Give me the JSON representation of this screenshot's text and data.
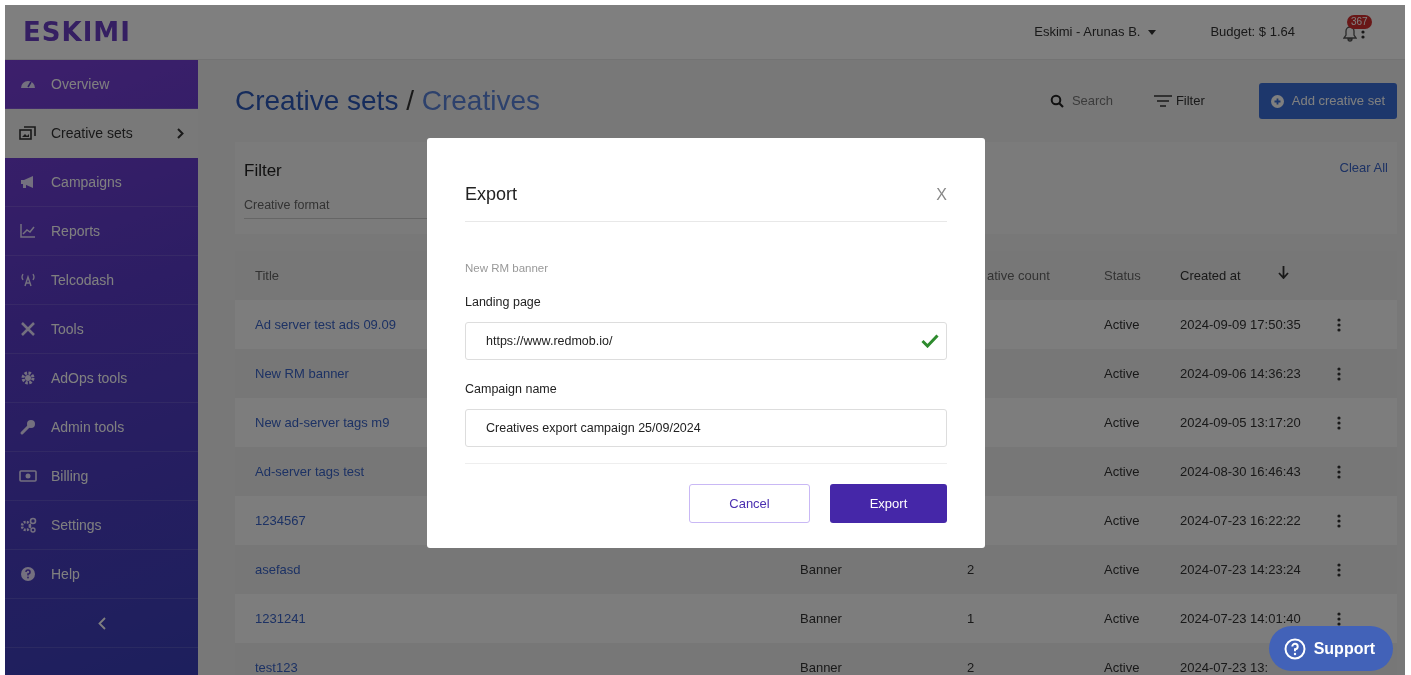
{
  "topbar": {
    "logo": "ESKIMI",
    "account": "Eskimi - Arunas B.",
    "budget": "Budget: $ 1.64",
    "notifications": "367"
  },
  "sidebar": {
    "items": [
      {
        "label": "Overview",
        "selected": false
      },
      {
        "label": "Creative sets",
        "selected": true
      },
      {
        "label": "Campaigns",
        "selected": false
      },
      {
        "label": "Reports",
        "selected": false
      },
      {
        "label": "Telcodash",
        "selected": false
      },
      {
        "label": "Tools",
        "selected": false
      },
      {
        "label": "AdOps tools",
        "selected": false
      },
      {
        "label": "Admin tools",
        "selected": false
      },
      {
        "label": "Billing",
        "selected": false
      },
      {
        "label": "Settings",
        "selected": false
      },
      {
        "label": "Help",
        "selected": false
      }
    ]
  },
  "page": {
    "title": "Creative sets",
    "separator": "/",
    "subtitle": "Creatives"
  },
  "toolbar": {
    "search_placeholder": "Search",
    "filter": "Filter",
    "add": "Add creative set"
  },
  "filter": {
    "title": "Filter",
    "field_placeholder": "Creative format",
    "clear": "Clear All"
  },
  "table": {
    "columns": [
      "Title",
      "ative count",
      "Status",
      "Created at"
    ],
    "rows": [
      {
        "title": "Ad server test ads 09.09",
        "status": "Active",
        "created": "2024-09-09 17:50:35"
      },
      {
        "title": "New RM banner",
        "status": "Active",
        "created": "2024-09-06 14:36:23"
      },
      {
        "title": "New ad-server tags m9",
        "status": "Active",
        "created": "2024-09-05 13:17:20"
      },
      {
        "title": "Ad-server tags test",
        "status": "Active",
        "created": "2024-08-30 16:46:43"
      },
      {
        "title": "1234567",
        "status": "Active",
        "created": "2024-07-23 16:22:22"
      },
      {
        "title": "asefasd",
        "format": "Banner",
        "count": "2",
        "status": "Active",
        "created": "2024-07-23 14:23:24"
      },
      {
        "title": "1231241",
        "format": "Banner",
        "count": "1",
        "status": "Active",
        "created": "2024-07-23 14:01:40"
      },
      {
        "title": "test123",
        "format": "Banner",
        "count": "2",
        "status": "Active",
        "created": "2024-07-23 13:"
      }
    ]
  },
  "modal": {
    "title": "Export",
    "close": "X",
    "subtitle": "New RM banner",
    "fields": [
      {
        "label": "Landing page",
        "value": "https://www.redmob.io/",
        "valid": true
      },
      {
        "label": "Campaign name",
        "value": "Creatives export campaign 25/09/2024",
        "valid": false
      }
    ],
    "buttons": [
      {
        "label": "Cancel",
        "kind": "secondary"
      },
      {
        "label": "Export",
        "kind": "primary"
      }
    ]
  },
  "support": {
    "label": "Support"
  }
}
